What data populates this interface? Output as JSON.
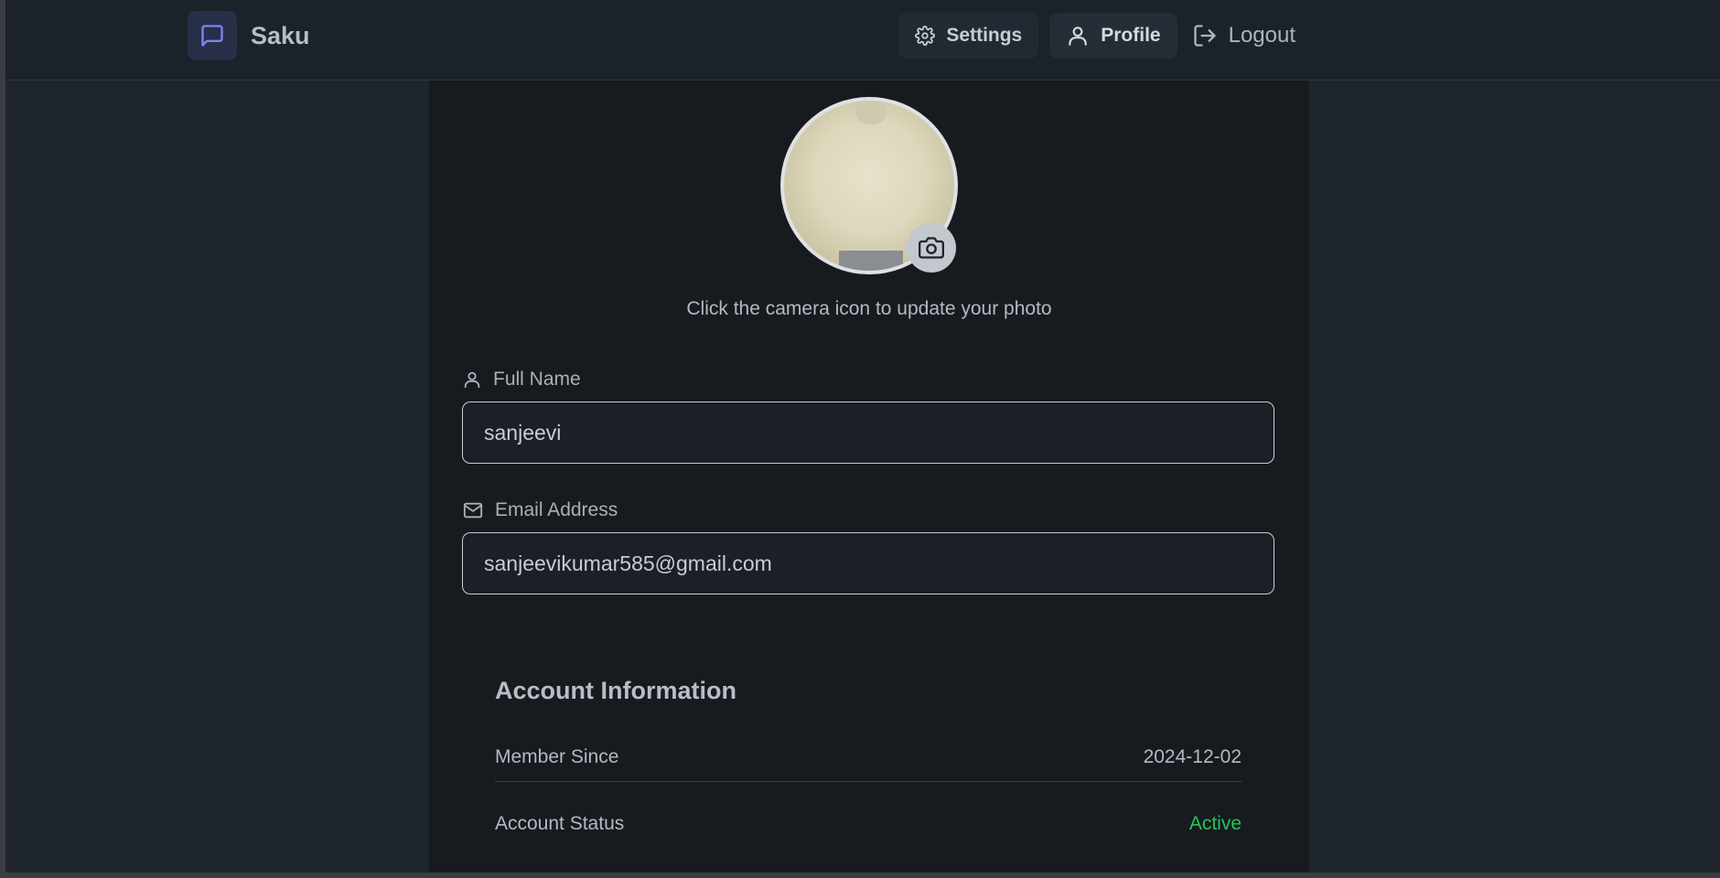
{
  "header": {
    "brand_name": "Saku",
    "nav": {
      "settings_label": "Settings",
      "profile_label": "Profile",
      "logout_label": "Logout"
    }
  },
  "profile": {
    "photo_hint": "Click the camera icon to update your photo",
    "full_name": {
      "label": "Full Name",
      "value": "sanjeevi"
    },
    "email": {
      "label": "Email Address",
      "value": "sanjeevikumar585@gmail.com"
    }
  },
  "account_info": {
    "title": "Account Information",
    "rows": [
      {
        "label": "Member Since",
        "value": "2024-12-02"
      },
      {
        "label": "Account Status",
        "value": "Active"
      }
    ]
  },
  "colors": {
    "accent": "#7c86f0",
    "status_active": "#22c55e",
    "panel_bg": "#171a1f",
    "page_bg": "#1f252d"
  },
  "icons": {
    "brand": "chat-bubble-icon",
    "settings": "gear-icon",
    "profile": "user-icon",
    "logout": "logout-icon",
    "camera": "camera-icon",
    "full_name": "user-icon",
    "email": "mail-icon"
  }
}
